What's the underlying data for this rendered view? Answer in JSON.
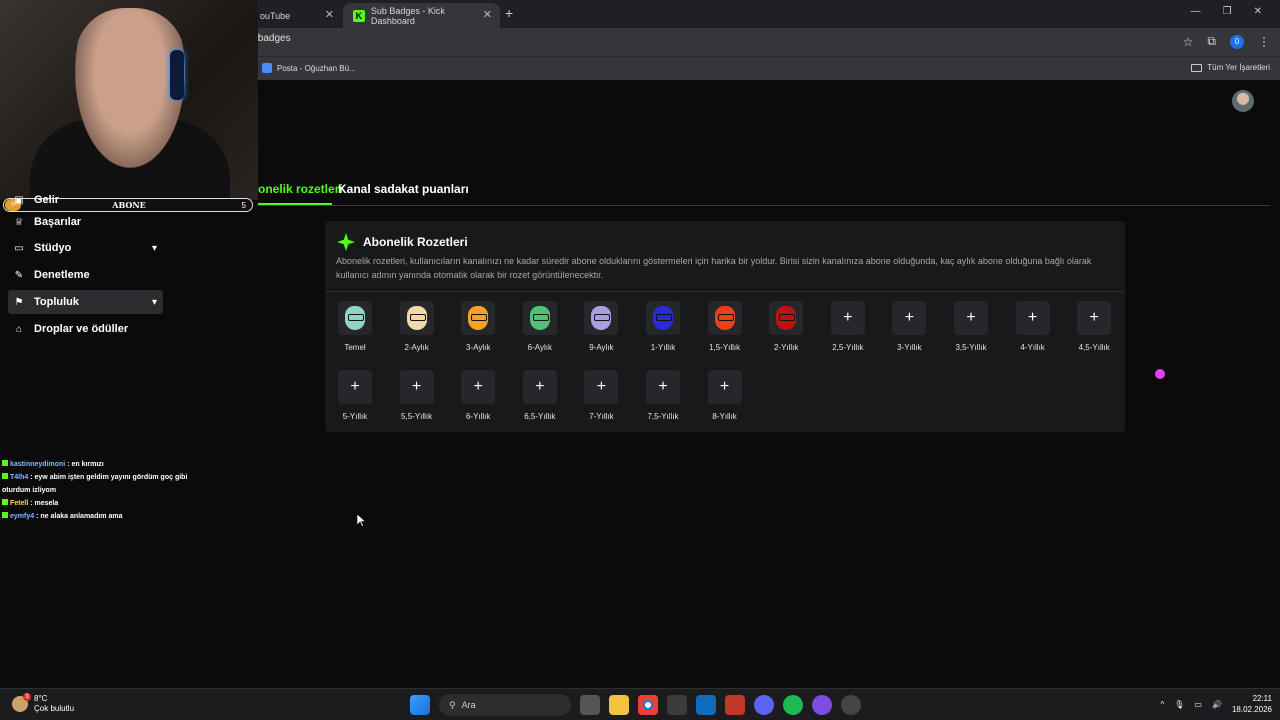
{
  "browser": {
    "tabs": [
      {
        "title": "ouTube",
        "active": false
      },
      {
        "title": "Sub Badges - Kick Dashboard",
        "active": true
      }
    ],
    "url": "/badges",
    "profile_count": "0",
    "bookmarks": [
      {
        "label": "Posta - Oğuzhan Bü..."
      }
    ],
    "all_bookmarks_label": "Tüm Yer İşaretleri"
  },
  "overlay": {
    "subscriber_label": "ABONE",
    "subscriber_count": "5",
    "subscriber_start": "0"
  },
  "sidebar": {
    "items": [
      {
        "label": "Gelir",
        "icon": "dollar-icon",
        "expandable": false,
        "selected": false
      },
      {
        "label": "Başarılar",
        "icon": "trophy-icon",
        "expandable": false,
        "selected": false
      },
      {
        "label": "Stüdyo",
        "icon": "studio-icon",
        "expandable": true,
        "selected": false
      },
      {
        "label": "Denetleme",
        "icon": "wrench-icon",
        "expandable": false,
        "selected": false
      },
      {
        "label": "Topluluk",
        "icon": "community-icon",
        "expandable": true,
        "selected": true
      },
      {
        "label": "Droplar ve ödüller",
        "icon": "gift-icon",
        "expandable": false,
        "selected": false
      }
    ]
  },
  "page": {
    "tabs": [
      {
        "label": "onelik rozetleri",
        "active": true
      },
      {
        "label": "Kanal sadakat puanları",
        "active": false
      }
    ],
    "card": {
      "title": "Abonelik Rozetleri",
      "description": "Abonelik rozetleri, kullanıcıların kanalınızı ne kadar süredir abone olduklarını göstermeleri için harika bir yoldur. Birisi sizin kanalınıza abone olduğunda, kaç aylık abone olduğuna bağlı olarak kullanıcı adının yanında otomatik olarak bir rozet görüntülenecektir."
    },
    "badges": [
      {
        "label": "Temel",
        "color": "#8fd6c4",
        "type": "image"
      },
      {
        "label": "2-Aylık",
        "color": "#f2d9a8",
        "type": "image"
      },
      {
        "label": "3-Aylık",
        "color": "#f2a324",
        "type": "image"
      },
      {
        "label": "6-Aylık",
        "color": "#4fc27a",
        "type": "image"
      },
      {
        "label": "9-Aylık",
        "color": "#a89ee0",
        "type": "image"
      },
      {
        "label": "1-Yıllık",
        "color": "#2a2ad8",
        "type": "image"
      },
      {
        "label": "1,5-Yıllık",
        "color": "#e8421a",
        "type": "image"
      },
      {
        "label": "2-Yıllık",
        "color": "#b81414",
        "type": "image"
      },
      {
        "label": "2,5-Yıllık",
        "type": "add"
      },
      {
        "label": "3-Yıllık",
        "type": "add"
      },
      {
        "label": "3,5-Yıllık",
        "type": "add"
      },
      {
        "label": "4-Yıllık",
        "type": "add"
      },
      {
        "label": "4,5-Yıllık",
        "type": "add"
      },
      {
        "label": "5-Yıllık",
        "type": "add"
      },
      {
        "label": "5,5-Yıllık",
        "type": "add"
      },
      {
        "label": "6-Yıllık",
        "type": "add"
      },
      {
        "label": "6,5-Yıllık",
        "type": "add"
      },
      {
        "label": "7-Yıllık",
        "type": "add"
      },
      {
        "label": "7,5-Yıllık",
        "type": "add"
      },
      {
        "label": "8-Yıllık",
        "type": "add"
      }
    ],
    "add_glyph": "+"
  },
  "chat": [
    {
      "user": "kastinneydimoni",
      "message": ": en kırmızı"
    },
    {
      "user": "T4lh4",
      "message": ": eyw abim işten geldim yayını gördüm goç gibi oturdum izliyom"
    },
    {
      "user": "Fetell",
      "message": ": mesela"
    },
    {
      "user": "eymfy4",
      "message": ": ne alaka anlamadım ama"
    }
  ],
  "taskbar": {
    "temperature": "8°C",
    "weather": "Çok bulutlu",
    "search_placeholder": "Ara",
    "time": "22:11",
    "date": "18.02.2026"
  },
  "colors": {
    "accent": "#53fc18",
    "background": "#0b0b0c",
    "card": "#18191b"
  }
}
